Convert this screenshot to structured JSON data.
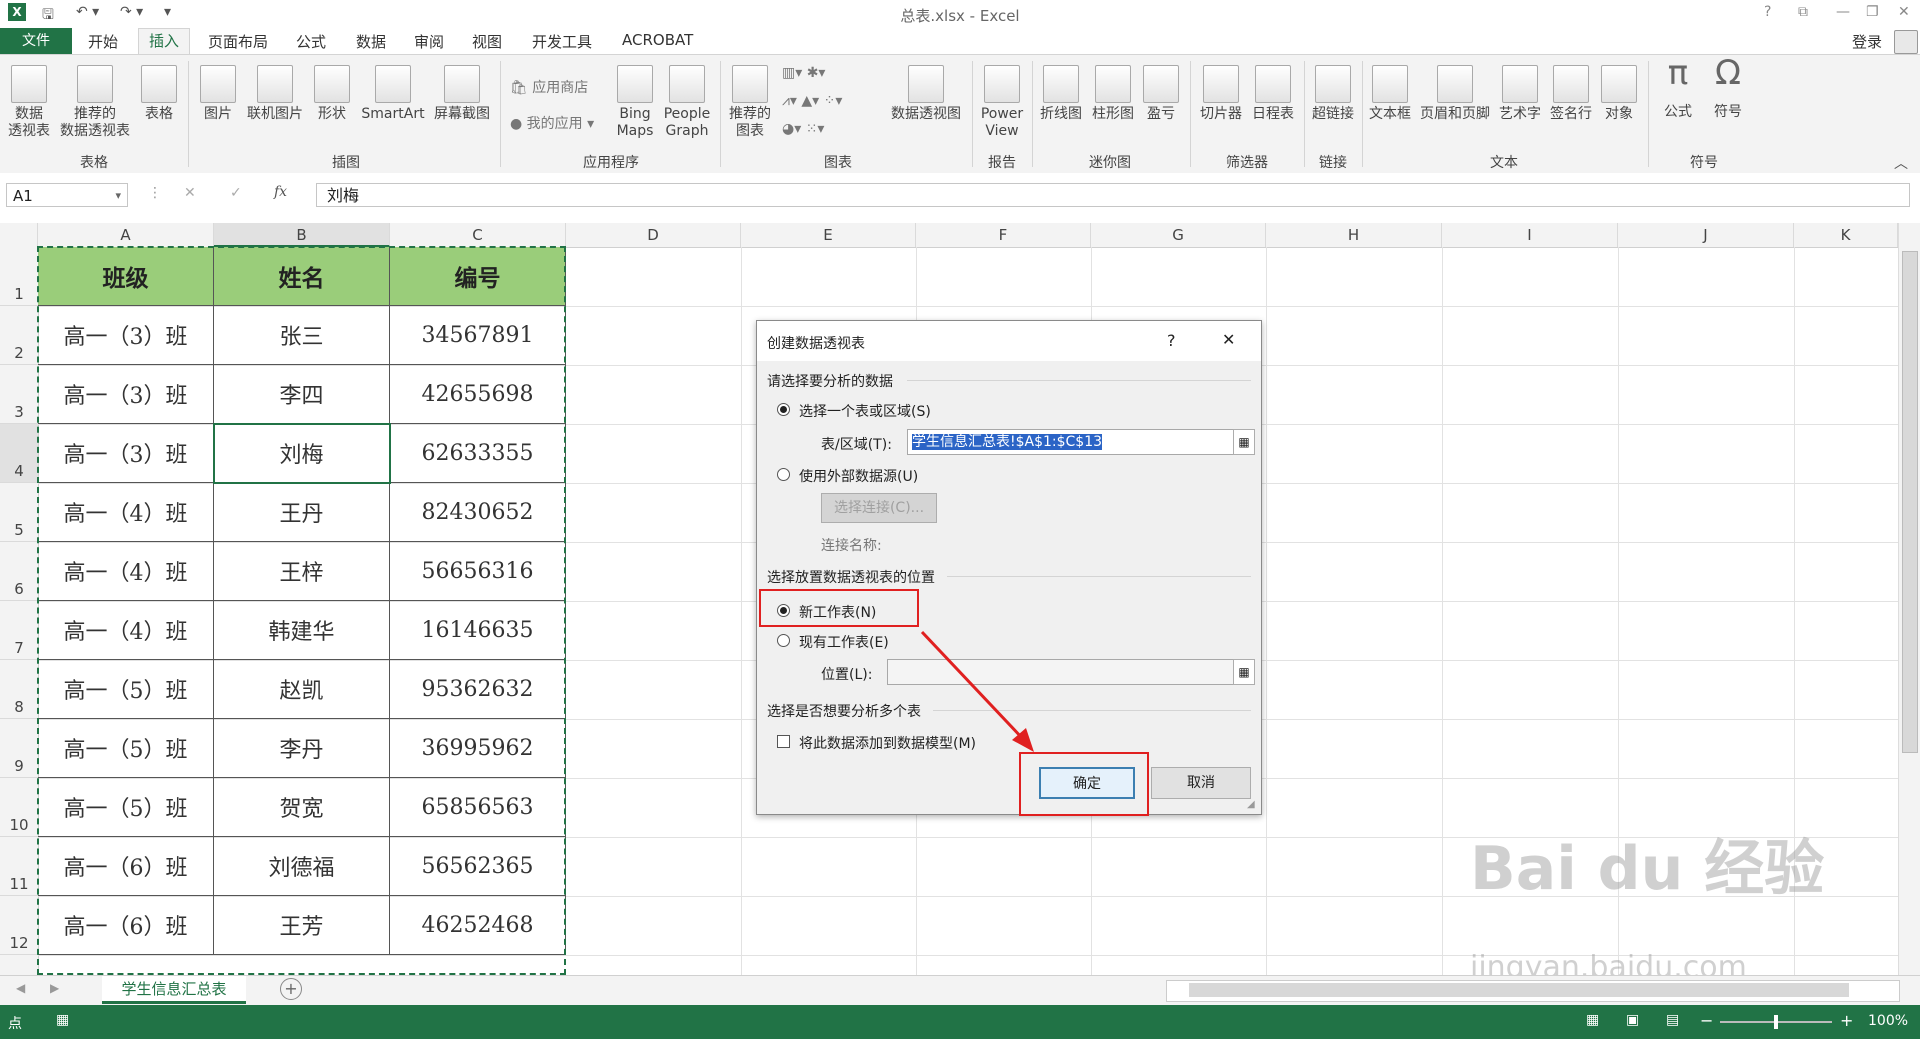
{
  "title_bar": {
    "document_title": "总表.xlsx - Excel",
    "help": "?"
  },
  "tabs": {
    "file": "文件",
    "items": [
      "开始",
      "插入",
      "页面布局",
      "公式",
      "数据",
      "审阅",
      "视图",
      "开发工具",
      "ACROBAT"
    ],
    "active": "插入",
    "signin": "登录"
  },
  "ribbon": {
    "groups": [
      {
        "label": "表格",
        "buttons": [
          "数据\n透视表",
          "推荐的\n数据透视表",
          "表格"
        ]
      },
      {
        "label": "插图",
        "buttons": [
          "图片",
          "联机图片",
          "形状",
          "SmartArt",
          "屏幕截图"
        ]
      },
      {
        "label": "应用程序",
        "buttons": [
          "应用商店",
          "我的应用",
          "Bing\nMaps",
          "People\nGraph"
        ]
      },
      {
        "label": "图表",
        "buttons": [
          "推荐的\n图表",
          "数据透视图"
        ]
      },
      {
        "label": "报告",
        "buttons": [
          "Power\nView"
        ]
      },
      {
        "label": "迷你图",
        "buttons": [
          "折线图",
          "柱形图",
          "盈亏"
        ]
      },
      {
        "label": "筛选器",
        "buttons": [
          "切片器",
          "日程表"
        ]
      },
      {
        "label": "链接",
        "buttons": [
          "超链接"
        ]
      },
      {
        "label": "文本",
        "buttons": [
          "文本框",
          "页眉和页脚",
          "艺术字",
          "签名行",
          "对象"
        ]
      },
      {
        "label": "符号",
        "buttons": [
          "公式",
          "符号"
        ]
      }
    ]
  },
  "formula_bar": {
    "name_box": "A1",
    "fx": "fx",
    "content": "刘梅"
  },
  "columns": [
    "A",
    "B",
    "C",
    "D",
    "E",
    "F",
    "G",
    "H",
    "I",
    "J",
    "K"
  ],
  "rows": [
    "1",
    "2",
    "3",
    "4",
    "5",
    "6",
    "7",
    "8",
    "9",
    "10",
    "11",
    "12"
  ],
  "table": {
    "headers": [
      "班级",
      "姓名",
      "编号"
    ],
    "data": [
      [
        "高一（3）班",
        "张三",
        "34567891"
      ],
      [
        "高一（3）班",
        "李四",
        "42655698"
      ],
      [
        "高一（3）班",
        "刘梅",
        "62633355"
      ],
      [
        "高一（4）班",
        "王丹",
        "82430652"
      ],
      [
        "高一（4）班",
        "王梓",
        "56656316"
      ],
      [
        "高一（4）班",
        "韩建华",
        "16146635"
      ],
      [
        "高一（5）班",
        "赵凯",
        "95362632"
      ],
      [
        "高一（5）班",
        "李丹",
        "36995962"
      ],
      [
        "高一（5）班",
        "贺宽",
        "65856563"
      ],
      [
        "高一（6）班",
        "刘德福",
        "56562365"
      ],
      [
        "高一（6）班",
        "王芳",
        "46252468"
      ]
    ]
  },
  "dialog": {
    "title": "创建数据透视表",
    "help": "?",
    "close": "✕",
    "section1": "请选择要分析的数据",
    "opt_range": "选择一个表或区域(S)",
    "range_label": "表/区域(T):",
    "range_value": "学生信息汇总表!$A$1:$C$13",
    "opt_external": "使用外部数据源(U)",
    "choose_conn": "选择连接(C)...",
    "conn_name": "连接名称:",
    "section2": "选择放置数据透视表的位置",
    "opt_new": "新工作表(N)",
    "opt_existing": "现有工作表(E)",
    "location_label": "位置(L):",
    "location_value": "",
    "section3": "选择是否想要分析多个表",
    "add_model": "将此数据添加到数据模型(M)",
    "ok": "确定",
    "cancel": "取消"
  },
  "sheet_tabs": {
    "active": "学生信息汇总表",
    "add": "+"
  },
  "status": {
    "mode": "点",
    "zoom": "100%"
  },
  "watermark": {
    "main": "Bai du 经验",
    "url": "jingyan.baidu.com"
  },
  "colors": {
    "excel_green": "#217346",
    "header_fill": "#9acd7a",
    "highlight": "#e02020"
  }
}
